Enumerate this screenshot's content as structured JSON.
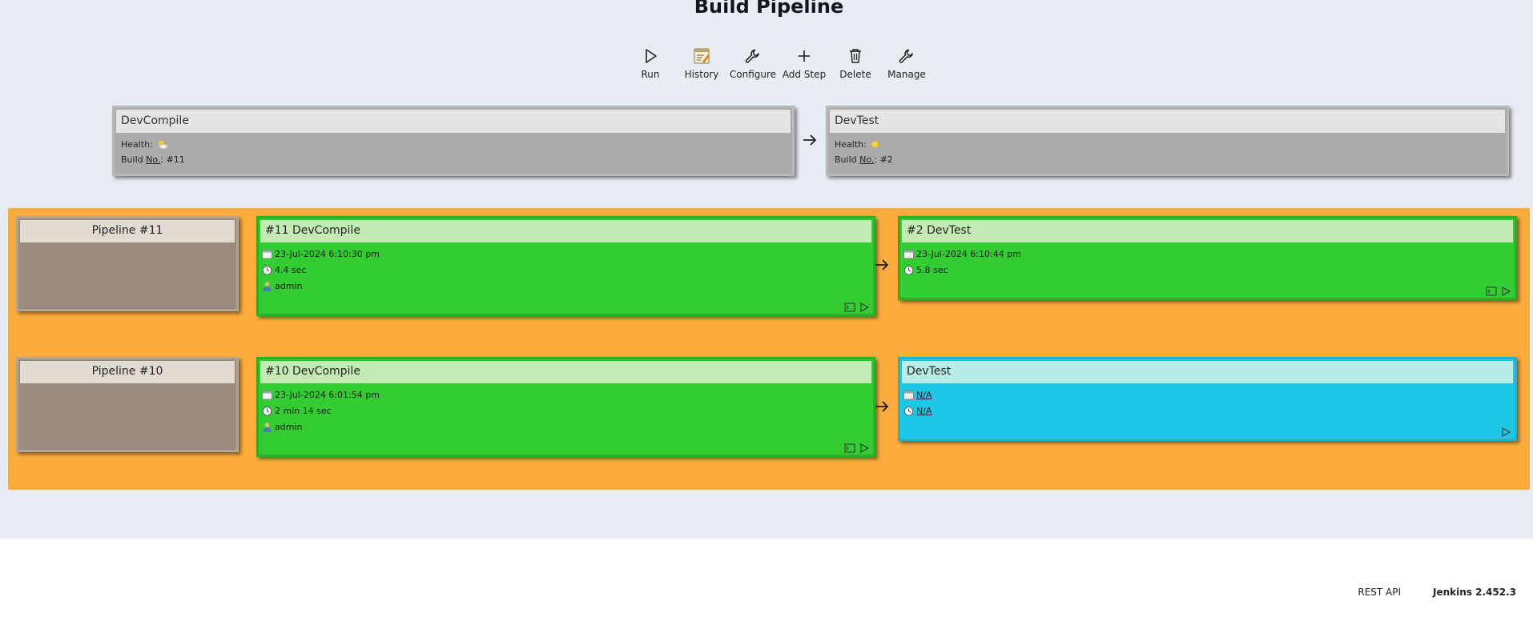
{
  "page": {
    "title": "Build Pipeline"
  },
  "toolbar": [
    {
      "label": "Run",
      "icon": "run-icon"
    },
    {
      "label": "History",
      "icon": "history-icon"
    },
    {
      "label": "Configure",
      "icon": "configure-icon"
    },
    {
      "label": "Add Step",
      "icon": "add-icon"
    },
    {
      "label": "Delete",
      "icon": "delete-icon"
    },
    {
      "label": "Manage",
      "icon": "manage-icon"
    }
  ],
  "jobs": [
    {
      "name": "DevCompile",
      "health_label": "Health:",
      "health_icon": "weather-partly-cloudy-icon",
      "build_label_a": "Build ",
      "build_label_b": "No.",
      "build_label_c": ": ",
      "build_number": "#11"
    },
    {
      "name": "DevTest",
      "health_label": "Health:",
      "health_icon": "weather-sunny-icon",
      "build_label_a": "Build ",
      "build_label_b": "No.",
      "build_label_c": ": ",
      "build_number": "#2"
    }
  ],
  "pipelines": [
    {
      "label": "Pipeline #11",
      "builds": [
        {
          "title": "#11 DevCompile",
          "date": "23-Jul-2024 6:10:30 pm",
          "duration": "4.4 sec",
          "user": "admin",
          "status": "success"
        },
        {
          "title": "#2 DevTest",
          "date": "23-Jul-2024 6:10:44 pm",
          "duration": "5.8 sec",
          "status": "success"
        }
      ]
    },
    {
      "label": "Pipeline #10",
      "builds": [
        {
          "title": "#10 DevCompile",
          "date": "23-Jul-2024 6:01:54 pm",
          "duration": "2 min 14 sec",
          "user": "admin",
          "status": "success"
        },
        {
          "title": "DevTest",
          "date": "N/A",
          "duration": "N/A",
          "status": "pending"
        }
      ]
    }
  ],
  "footer": {
    "rest_api": "REST API",
    "version": "Jenkins 2.452.3"
  },
  "colors": {
    "success": "#33cc33",
    "pending": "#1dc8e6",
    "pipeline_bg": "#fcac3c",
    "page_bg": "#e8ecf3"
  }
}
